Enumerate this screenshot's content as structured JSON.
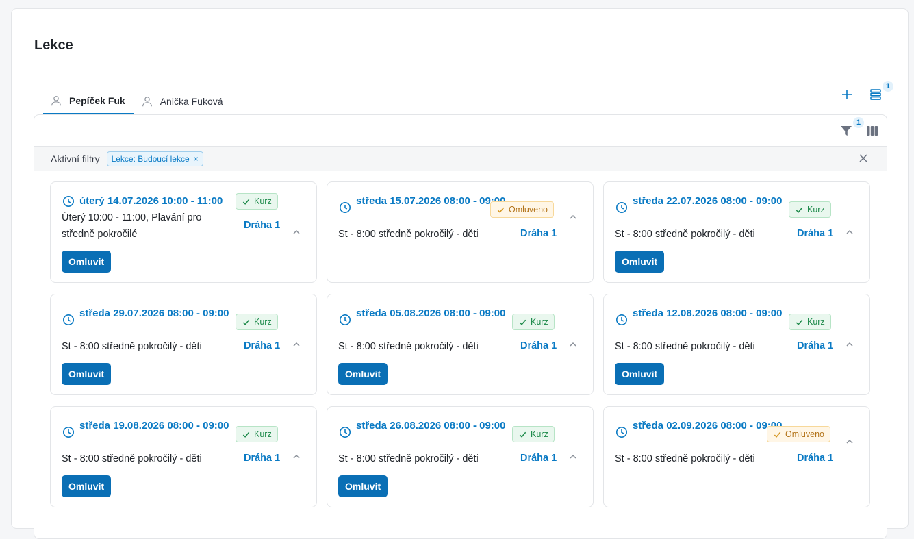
{
  "page": {
    "title": "Lekce"
  },
  "tabs": [
    {
      "label": "Pepíček Fuk",
      "active": true
    },
    {
      "label": "Anička Fuková",
      "active": false
    }
  ],
  "toolbar": {
    "list_count": "1",
    "filter_count": "1"
  },
  "filters": {
    "label": "Aktivní filtry",
    "chip": "Lekce: Budoucí lekce",
    "chip_remove": "×"
  },
  "colors": {
    "accent": "#0a7ac4",
    "button": "#0a6fb5",
    "kurz": "#1d8a4a",
    "omluveno": "#b3741a"
  },
  "cards": [
    {
      "date": "úterý 14.07.2026 10:00 - 11:00",
      "desc": "Úterý 10:00 - 11:00, Plavání pro středně pokročilé",
      "badge": "Kurz",
      "lane": "Dráha 1",
      "button": "Omluvit"
    },
    {
      "date": "středa 15.07.2026 08:00 - 09:00",
      "desc": "St - 8:00 středně pokročilý - děti",
      "badge": "Omluveno",
      "lane": "Dráha 1",
      "button": ""
    },
    {
      "date": "středa 22.07.2026 08:00 - 09:00",
      "desc": "St - 8:00 středně pokročilý - děti",
      "badge": "Kurz",
      "lane": "Dráha 1",
      "button": "Omluvit"
    },
    {
      "date": "středa 29.07.2026 08:00 - 09:00",
      "desc": "St - 8:00 středně pokročilý - děti",
      "badge": "Kurz",
      "lane": "Dráha 1",
      "button": "Omluvit"
    },
    {
      "date": "středa 05.08.2026 08:00 - 09:00",
      "desc": "St - 8:00 středně pokročilý - děti",
      "badge": "Kurz",
      "lane": "Dráha 1",
      "button": "Omluvit"
    },
    {
      "date": "středa 12.08.2026 08:00 - 09:00",
      "desc": "St - 8:00 středně pokročilý - děti",
      "badge": "Kurz",
      "lane": "Dráha 1",
      "button": "Omluvit"
    },
    {
      "date": "středa 19.08.2026 08:00 - 09:00",
      "desc": "St - 8:00 středně pokročilý - děti",
      "badge": "Kurz",
      "lane": "Dráha 1",
      "button": "Omluvit"
    },
    {
      "date": "středa 26.08.2026 08:00 - 09:00",
      "desc": "St - 8:00 středně pokročilý - děti",
      "badge": "Kurz",
      "lane": "Dráha 1",
      "button": "Omluvit"
    },
    {
      "date": "středa 02.09.2026 08:00 - 09:00",
      "desc": "St - 8:00 středně pokročilý - děti",
      "badge": "Omluveno",
      "lane": "Dráha 1",
      "button": ""
    }
  ]
}
